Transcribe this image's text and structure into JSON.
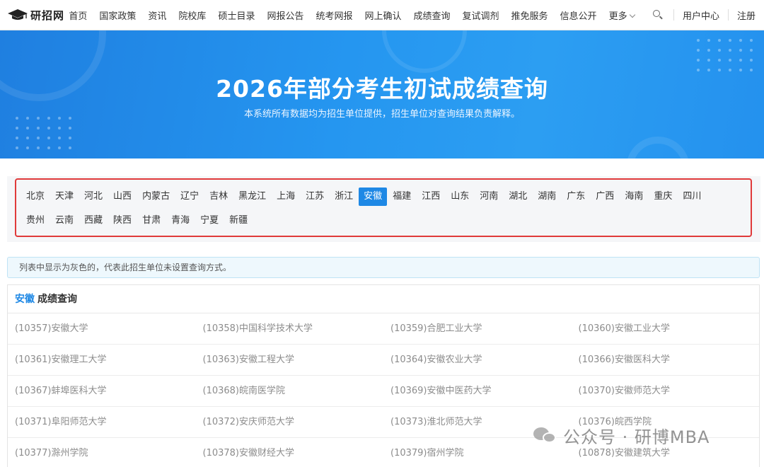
{
  "header": {
    "logo_text": "研招网",
    "nav": [
      "首页",
      "国家政策",
      "资讯",
      "院校库",
      "硕士目录",
      "网报公告",
      "统考网报",
      "网上确认",
      "成绩查询",
      "复试调剂",
      "推免服务",
      "信息公开",
      "更多"
    ],
    "user_center": "用户中心",
    "register": "注册"
  },
  "banner": {
    "title": "2026年部分考生初试成绩查询",
    "subtitle": "本系统所有数据均为招生单位提供，招生单位对查询结果负责解释。"
  },
  "provinces": {
    "row1": [
      "北京",
      "天津",
      "河北",
      "山西",
      "内蒙古",
      "辽宁",
      "吉林",
      "黑龙江",
      "上海",
      "江苏",
      "浙江",
      "安徽",
      "福建",
      "江西",
      "山东",
      "河南",
      "湖北",
      "湖南",
      "广东",
      "广西",
      "海南",
      "重庆",
      "四川"
    ],
    "row2": [
      "贵州",
      "云南",
      "西藏",
      "陕西",
      "甘肃",
      "青海",
      "宁夏",
      "新疆"
    ],
    "selected": "安徽"
  },
  "notice": "列表中显示为灰色的，代表此招生单位未设置查询方式。",
  "result": {
    "province": "安徽",
    "heading": "成绩查询",
    "rows": [
      [
        "(10357)安徽大学",
        "(10358)中国科学技术大学",
        "(10359)合肥工业大学",
        "(10360)安徽工业大学"
      ],
      [
        "(10361)安徽理工大学",
        "(10363)安徽工程大学",
        "(10364)安徽农业大学",
        "(10366)安徽医科大学"
      ],
      [
        "(10367)蚌埠医科大学",
        "(10368)皖南医学院",
        "(10369)安徽中医药大学",
        "(10370)安徽师范大学"
      ],
      [
        "(10371)阜阳师范大学",
        "(10372)安庆师范大学",
        "(10373)淮北师范大学",
        "(10376)皖西学院"
      ],
      [
        "(10377)滁州学院",
        "(10378)安徽财经大学",
        "(10379)宿州学院",
        "(10878)安徽建筑大学"
      ]
    ]
  },
  "watermark": "公众号 · 研博MBA"
}
